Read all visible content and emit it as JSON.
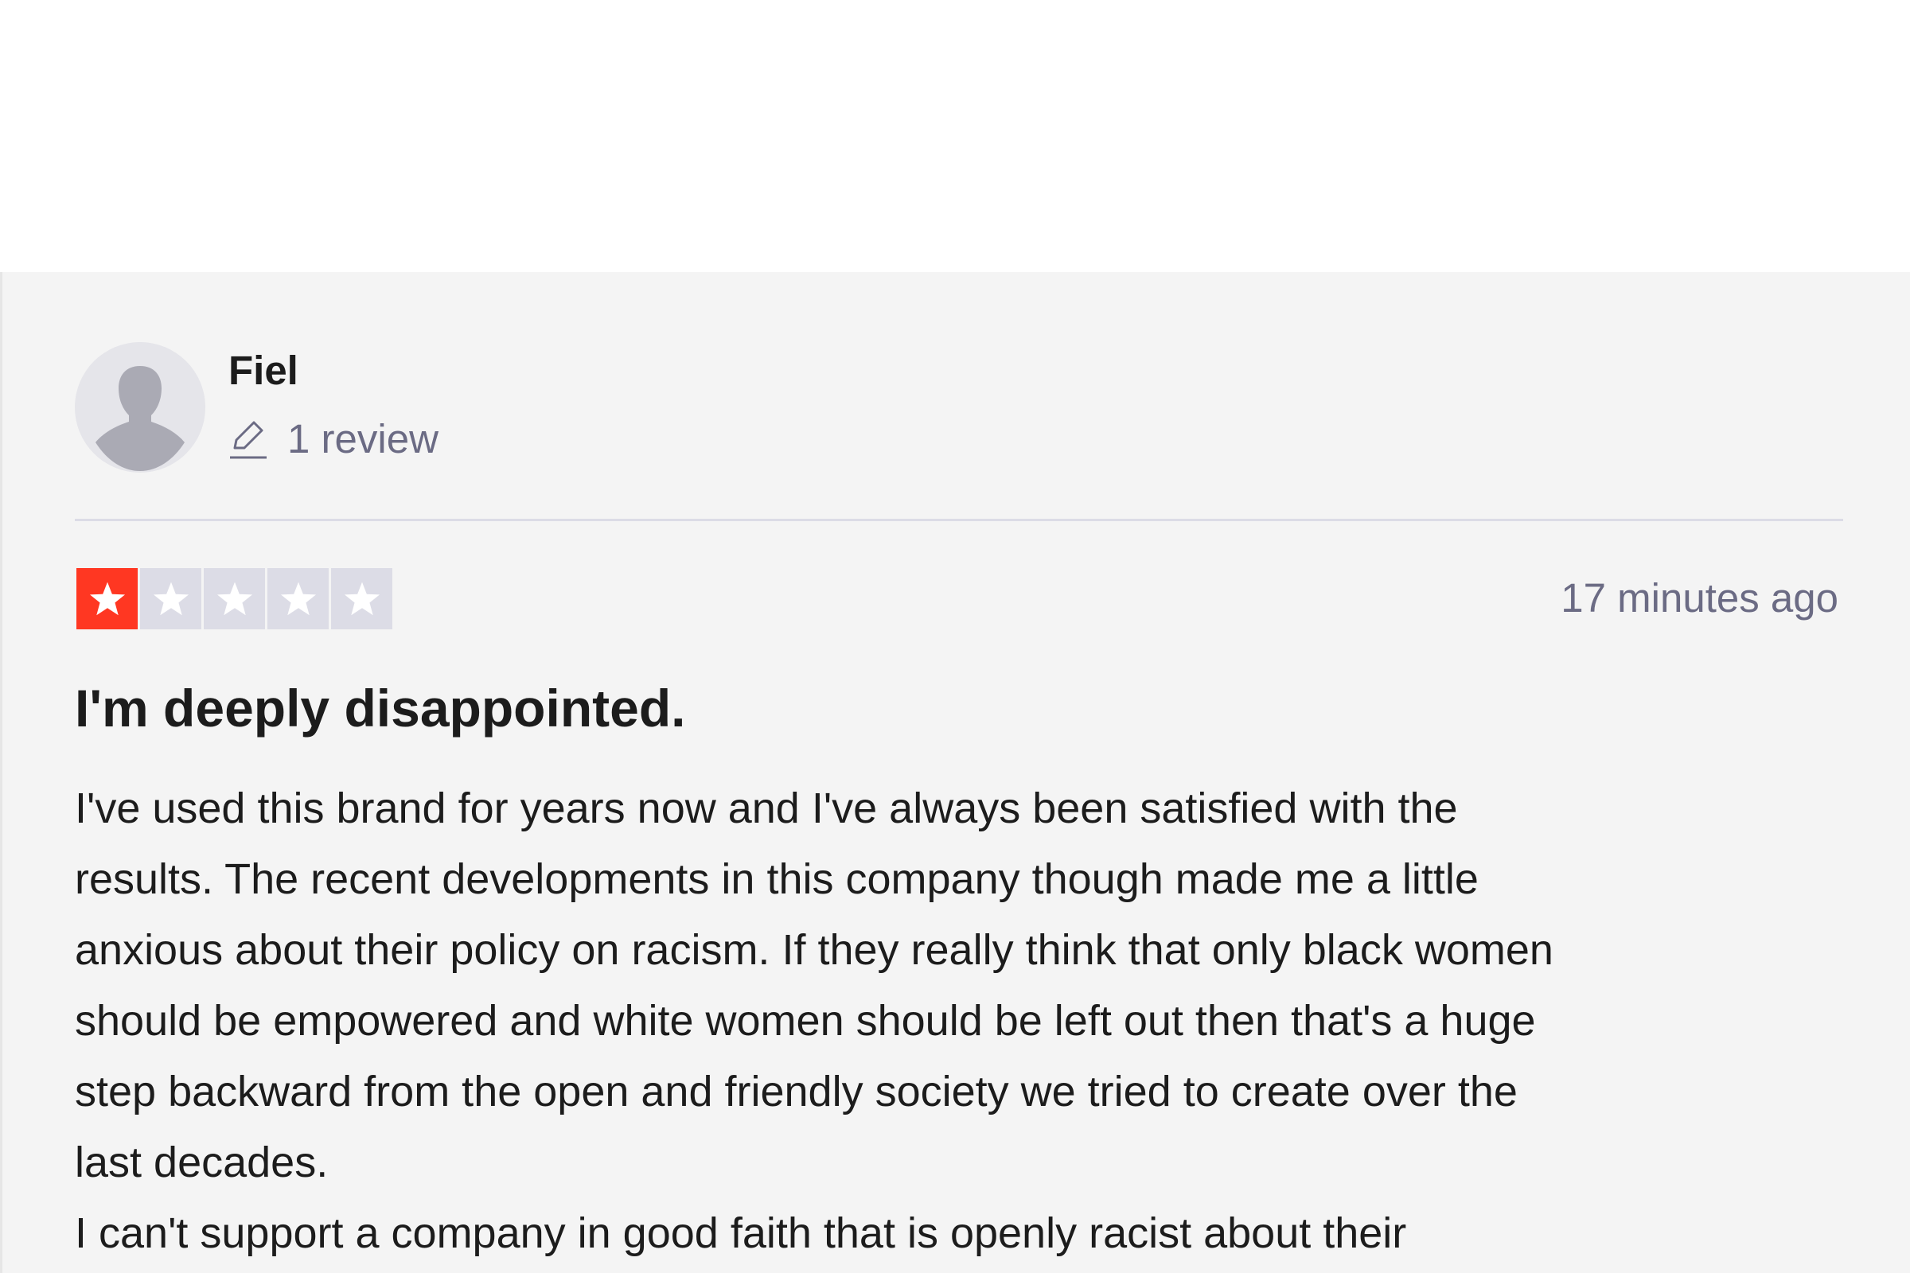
{
  "review": {
    "consumer": {
      "name": "Fiel",
      "review_count": "1 review",
      "avatar_icon": "default-avatar-icon"
    },
    "rating": {
      "stars": 1,
      "max_stars": 5,
      "filled_color": "#ff3722",
      "empty_color": "#dcdce6"
    },
    "date": "17 minutes ago",
    "title": "I'm deeply disappointed.",
    "body_lines": [
      "I've used this brand for years now and I've always been satisfied with the",
      "results. The recent developments in this company though made me a little",
      "anxious about their policy on racism. If they really think that only black women",
      "should be empowered and white women should be left out then that's a huge",
      "step backward from the open and friendly society we tried to create over the",
      "last decades.",
      "I can't support a company in good faith that is openly racist about their"
    ]
  }
}
